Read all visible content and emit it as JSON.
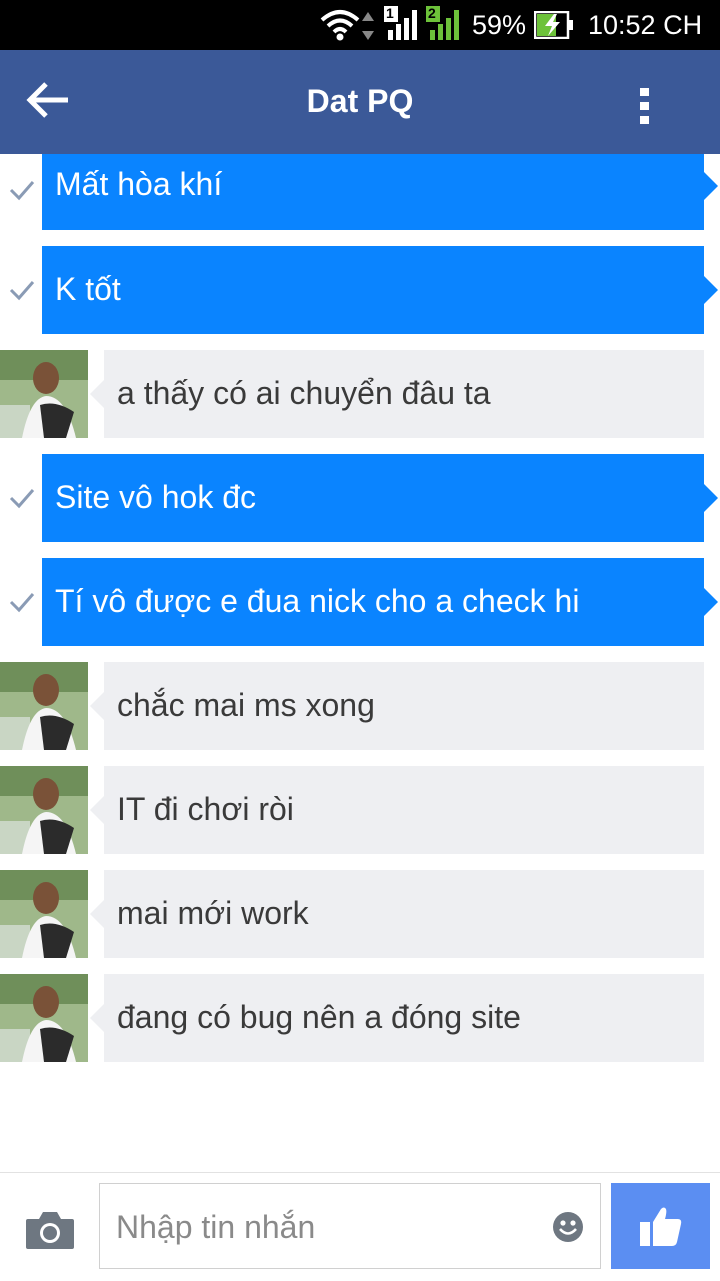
{
  "status_bar": {
    "battery_percent": "59%",
    "time": "10:52 CH",
    "sim1_label": "1",
    "sim2_label": "2"
  },
  "header": {
    "title": "Dat PQ",
    "back_icon": "arrow-left-icon",
    "menu_icon": "more-vert-icon"
  },
  "messages": [
    {
      "direction": "out",
      "text": "Mất hòa khí"
    },
    {
      "direction": "out",
      "text": "K tốt"
    },
    {
      "direction": "in",
      "text": "a thấy có ai chuyển đâu ta"
    },
    {
      "direction": "out",
      "text": "Site vô hok đc"
    },
    {
      "direction": "out",
      "text": "Tí vô được e đua nick cho a check hi"
    },
    {
      "direction": "in",
      "text": "chắc mai ms xong"
    },
    {
      "direction": "in",
      "text": "IT đi chơi ròi"
    },
    {
      "direction": "in",
      "text": "mai mới work"
    },
    {
      "direction": "in",
      "text": "đang có bug nên a đóng site"
    }
  ],
  "composer": {
    "placeholder": "Nhập tin nhắn",
    "camera_icon": "camera-icon",
    "emoji_icon": "emoji-icon",
    "like_icon": "thumbs-up-icon"
  },
  "colors": {
    "app_bar": "#3b5998",
    "outgoing_bubble": "#0a84ff",
    "incoming_bubble": "#eeeff2",
    "like_button": "#5b8ef2"
  }
}
